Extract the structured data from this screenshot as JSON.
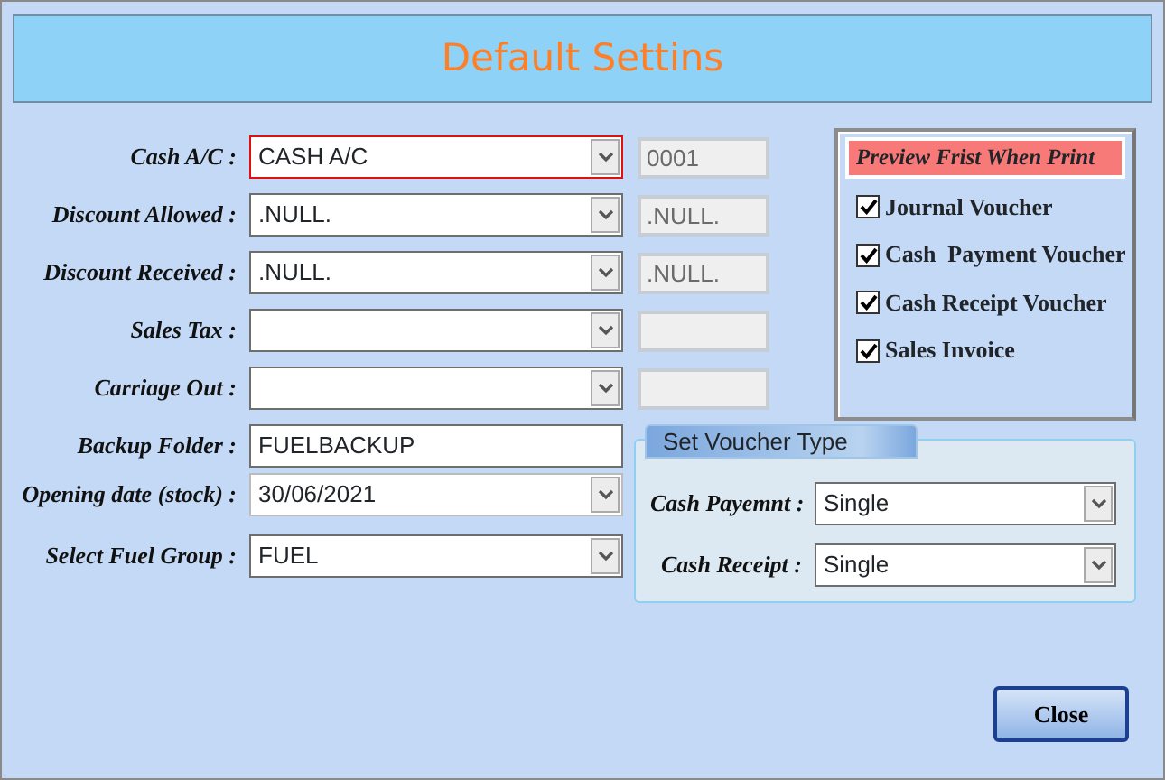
{
  "window": {
    "title": "Default Settins"
  },
  "accounts": [
    {
      "label": "Cash A/C :",
      "value": "CASH A/C",
      "focused": true,
      "code": "0001"
    },
    {
      "label": "Discount Allowed :",
      "value": ".NULL.",
      "focused": false,
      "code": ".NULL."
    },
    {
      "label": "Discount Received :",
      "value": ".NULL.",
      "focused": false,
      "code": ".NULL."
    },
    {
      "label": "Sales Tax :",
      "focused": false
    },
    {
      "label": "Carriage Out :",
      "focused": false
    }
  ],
  "settings": [
    {
      "kind": "text",
      "label": "Backup Folder :",
      "value": "FUELBACKUP"
    },
    {
      "kind": "date",
      "label": "Opening date (stock) :",
      "value": "30/06/2021"
    },
    {
      "kind": "combo",
      "label": "Select Fuel Group :",
      "value": "FUEL"
    }
  ],
  "preview": {
    "title": "Preview Frist When Print",
    "items": [
      {
        "label": "Journal Voucher",
        "checked": true
      },
      {
        "label": "Cash  Payment Voucher",
        "checked": true
      },
      {
        "label": "Cash Receipt Voucher",
        "checked": true
      },
      {
        "label": "Sales Invoice",
        "checked": true
      }
    ]
  },
  "voucher_type": {
    "title": "Set Voucher Type",
    "fields": [
      {
        "label": "Cash Payemnt :",
        "value": "Single"
      },
      {
        "label": "Cash Receipt :",
        "value": "Single"
      }
    ]
  },
  "buttons": [
    {
      "label": "Close"
    }
  ]
}
